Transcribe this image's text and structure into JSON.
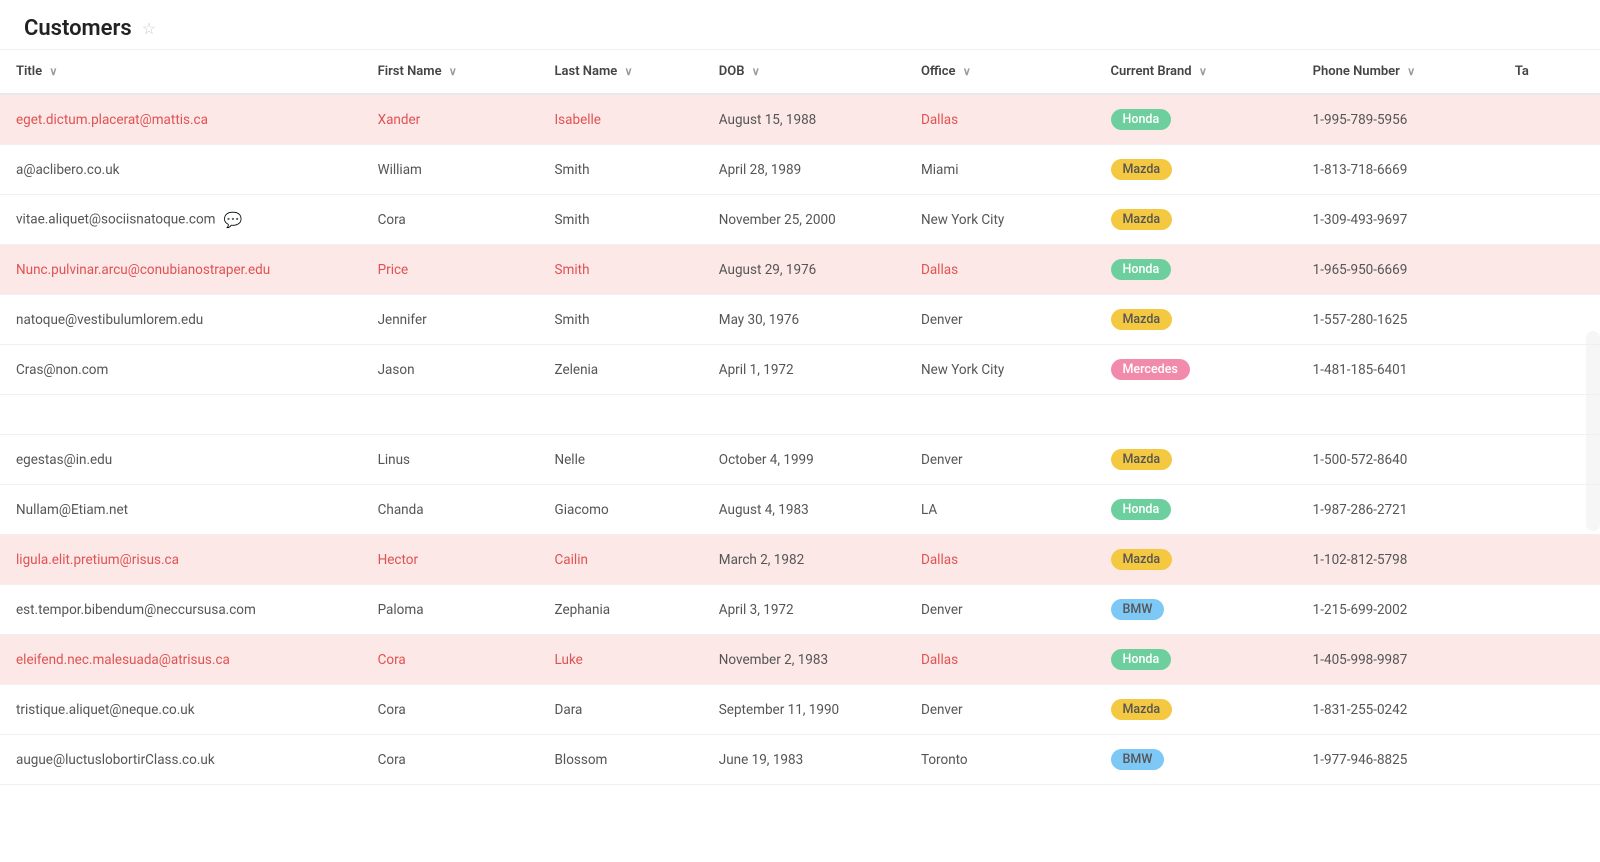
{
  "header": {
    "title": "Customers",
    "star": "☆"
  },
  "columns": [
    {
      "key": "title",
      "label": "Title",
      "sortable": true
    },
    {
      "key": "firstName",
      "label": "First Name",
      "sortable": true
    },
    {
      "key": "lastName",
      "label": "Last Name",
      "sortable": true
    },
    {
      "key": "dob",
      "label": "DOB",
      "sortable": true
    },
    {
      "key": "office",
      "label": "Office",
      "sortable": true
    },
    {
      "key": "brand",
      "label": "Current Brand",
      "sortable": true
    },
    {
      "key": "phone",
      "label": "Phone Number",
      "sortable": true
    },
    {
      "key": "ta",
      "label": "Ta",
      "sortable": false
    }
  ],
  "rows": [
    {
      "title": "eget.dictum.placerat@mattis.ca",
      "firstName": "Xander",
      "lastName": "Isabelle",
      "dob": "August 15, 1988",
      "office": "Dallas",
      "brand": "Honda",
      "brandClass": "honda",
      "phone": "1-995-789-5956",
      "highlighted": true,
      "hasChat": false
    },
    {
      "title": "a@aclibero.co.uk",
      "firstName": "William",
      "lastName": "Smith",
      "dob": "April 28, 1989",
      "office": "Miami",
      "brand": "Mazda",
      "brandClass": "mazda",
      "phone": "1-813-718-6669",
      "highlighted": false,
      "hasChat": false
    },
    {
      "title": "vitae.aliquet@sociisnatoque.com",
      "firstName": "Cora",
      "lastName": "Smith",
      "dob": "November 25, 2000",
      "office": "New York City",
      "brand": "Mazda",
      "brandClass": "mazda",
      "phone": "1-309-493-9697",
      "highlighted": false,
      "hasChat": true
    },
    {
      "title": "Nunc.pulvinar.arcu@conubianostraper.edu",
      "firstName": "Price",
      "lastName": "Smith",
      "dob": "August 29, 1976",
      "office": "Dallas",
      "brand": "Honda",
      "brandClass": "honda",
      "phone": "1-965-950-6669",
      "highlighted": true,
      "hasChat": false
    },
    {
      "title": "natoque@vestibulumlorem.edu",
      "firstName": "Jennifer",
      "lastName": "Smith",
      "dob": "May 30, 1976",
      "office": "Denver",
      "brand": "Mazda",
      "brandClass": "mazda",
      "phone": "1-557-280-1625",
      "highlighted": false,
      "hasChat": false
    },
    {
      "title": "Cras@non.com",
      "firstName": "Jason",
      "lastName": "Zelenia",
      "dob": "April 1, 1972",
      "office": "New York City",
      "brand": "Mercedes",
      "brandClass": "mercedes",
      "phone": "1-481-185-6401",
      "highlighted": false,
      "hasChat": false
    },
    {
      "title": "",
      "firstName": "",
      "lastName": "",
      "dob": "",
      "office": "",
      "brand": "",
      "brandClass": "",
      "phone": "",
      "highlighted": false,
      "hasChat": false,
      "empty": true
    },
    {
      "title": "egestas@in.edu",
      "firstName": "Linus",
      "lastName": "Nelle",
      "dob": "October 4, 1999",
      "office": "Denver",
      "brand": "Mazda",
      "brandClass": "mazda",
      "phone": "1-500-572-8640",
      "highlighted": false,
      "hasChat": false
    },
    {
      "title": "Nullam@Etiam.net",
      "firstName": "Chanda",
      "lastName": "Giacomo",
      "dob": "August 4, 1983",
      "office": "LA",
      "brand": "Honda",
      "brandClass": "honda",
      "phone": "1-987-286-2721",
      "highlighted": false,
      "hasChat": false
    },
    {
      "title": "ligula.elit.pretium@risus.ca",
      "firstName": "Hector",
      "lastName": "Cailin",
      "dob": "March 2, 1982",
      "office": "Dallas",
      "brand": "Mazda",
      "brandClass": "mazda",
      "phone": "1-102-812-5798",
      "highlighted": true,
      "hasChat": false
    },
    {
      "title": "est.tempor.bibendum@neccursusa.com",
      "firstName": "Paloma",
      "lastName": "Zephania",
      "dob": "April 3, 1972",
      "office": "Denver",
      "brand": "BMW",
      "brandClass": "bmw",
      "phone": "1-215-699-2002",
      "highlighted": false,
      "hasChat": false
    },
    {
      "title": "eleifend.nec.malesuada@atrisus.ca",
      "firstName": "Cora",
      "lastName": "Luke",
      "dob": "November 2, 1983",
      "office": "Dallas",
      "brand": "Honda",
      "brandClass": "honda",
      "phone": "1-405-998-9987",
      "highlighted": true,
      "hasChat": false
    },
    {
      "title": "tristique.aliquet@neque.co.uk",
      "firstName": "Cora",
      "lastName": "Dara",
      "dob": "September 11, 1990",
      "office": "Denver",
      "brand": "Mazda",
      "brandClass": "mazda",
      "phone": "1-831-255-0242",
      "highlighted": false,
      "hasChat": false
    },
    {
      "title": "augue@luctuslobortirClass.co.uk",
      "firstName": "Cora",
      "lastName": "Blossom",
      "dob": "June 19, 1983",
      "office": "Toronto",
      "brand": "BMW",
      "brandClass": "bmw",
      "phone": "1-977-946-8825",
      "highlighted": false,
      "hasChat": false
    }
  ]
}
